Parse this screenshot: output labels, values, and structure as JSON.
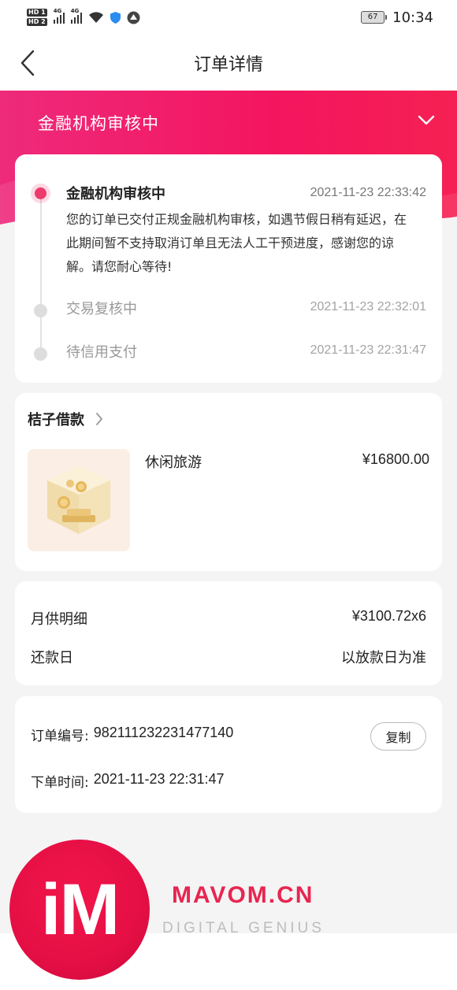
{
  "status_bar": {
    "sim1_badge": "HD 1",
    "sim2_badge": "HD 2",
    "network1": "4G",
    "network2": "4G",
    "battery": "67",
    "time": "10:34"
  },
  "nav": {
    "title": "订单详情",
    "back_icon": "chevron-left-icon"
  },
  "banner": {
    "status_title": "金融机构审核中",
    "toggle_icon": "chevron-down-icon",
    "color_start": "#ee2a7b",
    "color_end": "#f52053"
  },
  "timeline": {
    "accent_color": "#ec3b6c",
    "steps": [
      {
        "title": "金融机构审核中",
        "time": "2021-11-23 22:33:42",
        "desc_lines": [
          "您的订单已交付正规金融机构审核，如遇节假日稍有延迟，在",
          "此期间暂不支持取消订单且无法人工干预进度，感谢您的谅",
          "解。请您耐心等待!"
        ]
      },
      {
        "title": "交易复核中",
        "time": "2021-11-23 22:32:01"
      },
      {
        "title": "待信用支付",
        "time": "2021-11-23 22:31:47"
      }
    ]
  },
  "product": {
    "shop_name": "桔子借款",
    "shop_arrow_icon": "chevron-right-icon",
    "image_icon": "gold-coin-box-icon",
    "name": "休闲旅游",
    "price": "¥16800.00"
  },
  "monthly": {
    "installment_label": "月供明细",
    "installment_value": "¥3100.72x6",
    "repay_label": "还款日",
    "repay_value": "以放款日为准"
  },
  "order": {
    "number_label": "订单编号:",
    "number_value": "982111232231477140",
    "copy_button": "复制",
    "time_label": "下单时间:",
    "time_value": "2021-11-23 22:31:47"
  },
  "watermark": {
    "logo_text": "iM",
    "site": "MAVOM.CN",
    "tagline": "DIGITAL GENIUS"
  }
}
